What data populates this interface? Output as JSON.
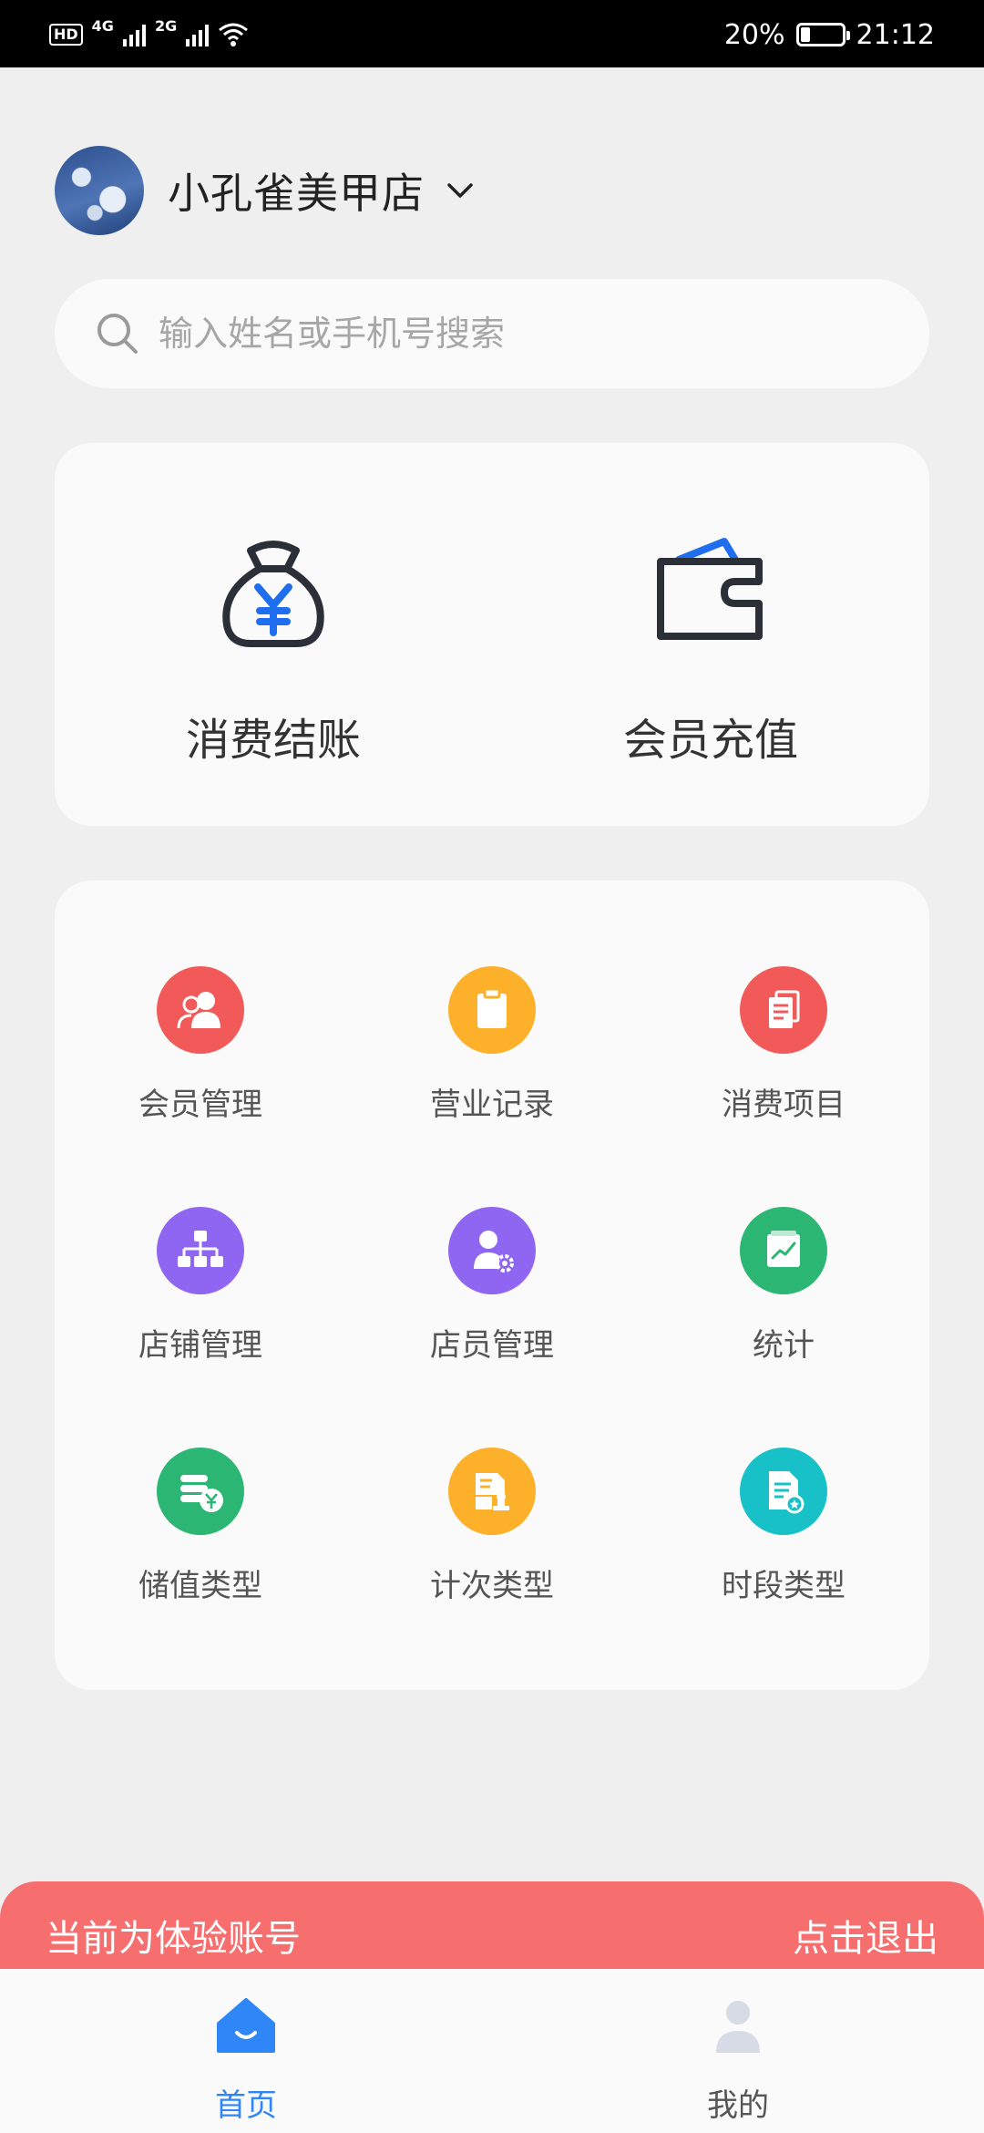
{
  "status_bar": {
    "left_badge": "HD",
    "net1": "4G",
    "net2": "2G",
    "battery": "20%",
    "time": "21:12"
  },
  "header": {
    "store_name": "小孔雀美甲店"
  },
  "search": {
    "placeholder": "输入姓名或手机号搜索"
  },
  "quick_actions": [
    {
      "label": "消费结账",
      "icon": "money-bag-icon"
    },
    {
      "label": "会员充值",
      "icon": "wallet-icon"
    }
  ],
  "grid": [
    {
      "label": "会员管理",
      "icon": "members-icon",
      "color": "#f25a5a"
    },
    {
      "label": "营业记录",
      "icon": "clipboard-icon",
      "color": "#fdb12a"
    },
    {
      "label": "消费项目",
      "icon": "document-icon",
      "color": "#f25a5a"
    },
    {
      "label": "店铺管理",
      "icon": "org-chart-icon",
      "color": "#8e66f2"
    },
    {
      "label": "店员管理",
      "icon": "staff-settings-icon",
      "color": "#8e66f2"
    },
    {
      "label": "统计",
      "icon": "chart-icon",
      "color": "#2bb673"
    },
    {
      "label": "储值类型",
      "icon": "coins-icon",
      "color": "#2bb673"
    },
    {
      "label": "计次类型",
      "icon": "stamp-icon",
      "color": "#fdb12a"
    },
    {
      "label": "时段类型",
      "icon": "certificate-icon",
      "color": "#18c0c8"
    }
  ],
  "trial_banner": {
    "text": "当前为体验账号",
    "action": "点击退出",
    "color": "#f76e6e"
  },
  "tabs": [
    {
      "label": "首页",
      "active": true,
      "color": "#2f86f6"
    },
    {
      "label": "我的",
      "active": false,
      "color": "#555555"
    }
  ]
}
